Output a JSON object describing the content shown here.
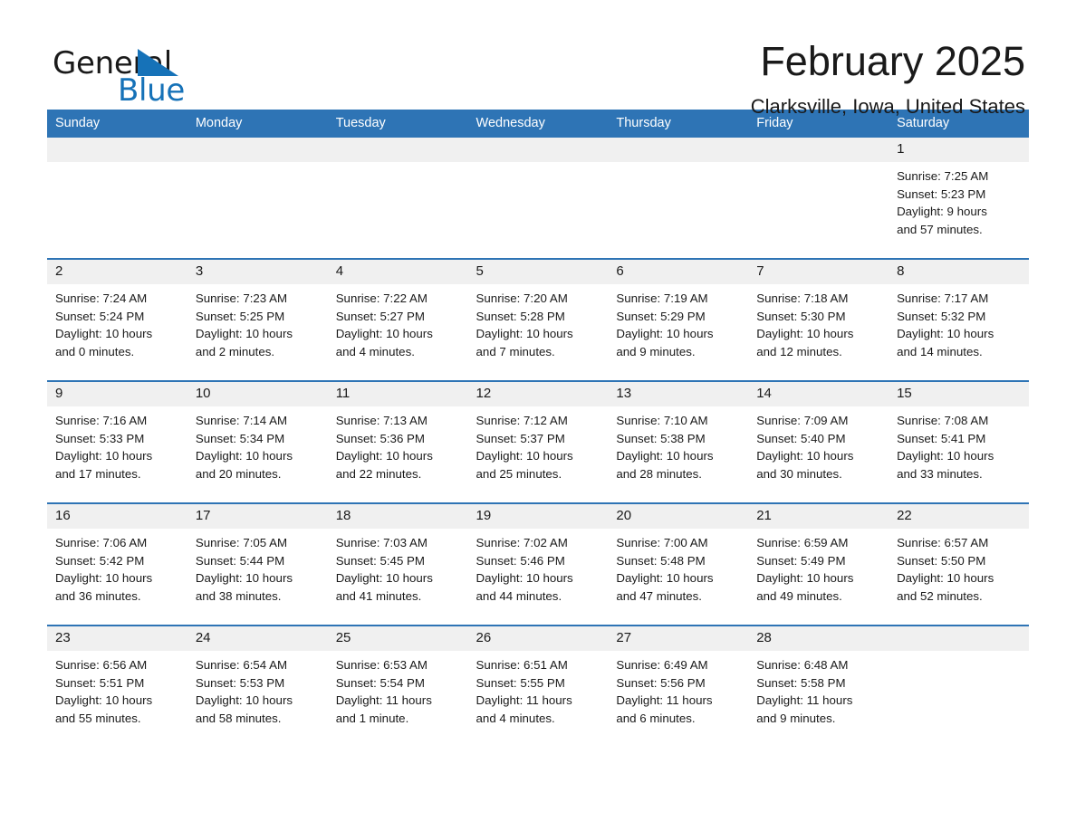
{
  "brand": {
    "name_part1": "General",
    "name_part2": "Blue",
    "accent_color": "#1672b8"
  },
  "header": {
    "month_title": "February 2025",
    "location": "Clarksville, Iowa, United States"
  },
  "theme": {
    "header_blue": "#2e74b5",
    "daynum_bg": "#f0f0f0"
  },
  "weekdays": [
    "Sunday",
    "Monday",
    "Tuesday",
    "Wednesday",
    "Thursday",
    "Friday",
    "Saturday"
  ],
  "labels": {
    "sunrise_prefix": "Sunrise:",
    "sunset_prefix": "Sunset:",
    "daylight_prefix": "Daylight:"
  },
  "weeks": [
    [
      {
        "day": "",
        "sunrise": "",
        "sunset": "",
        "daylight_line1": "",
        "daylight_line2": ""
      },
      {
        "day": "",
        "sunrise": "",
        "sunset": "",
        "daylight_line1": "",
        "daylight_line2": ""
      },
      {
        "day": "",
        "sunrise": "",
        "sunset": "",
        "daylight_line1": "",
        "daylight_line2": ""
      },
      {
        "day": "",
        "sunrise": "",
        "sunset": "",
        "daylight_line1": "",
        "daylight_line2": ""
      },
      {
        "day": "",
        "sunrise": "",
        "sunset": "",
        "daylight_line1": "",
        "daylight_line2": ""
      },
      {
        "day": "",
        "sunrise": "",
        "sunset": "",
        "daylight_line1": "",
        "daylight_line2": ""
      },
      {
        "day": "1",
        "sunrise": "Sunrise: 7:25 AM",
        "sunset": "Sunset: 5:23 PM",
        "daylight_line1": "Daylight: 9 hours",
        "daylight_line2": "and 57 minutes."
      }
    ],
    [
      {
        "day": "2",
        "sunrise": "Sunrise: 7:24 AM",
        "sunset": "Sunset: 5:24 PM",
        "daylight_line1": "Daylight: 10 hours",
        "daylight_line2": "and 0 minutes."
      },
      {
        "day": "3",
        "sunrise": "Sunrise: 7:23 AM",
        "sunset": "Sunset: 5:25 PM",
        "daylight_line1": "Daylight: 10 hours",
        "daylight_line2": "and 2 minutes."
      },
      {
        "day": "4",
        "sunrise": "Sunrise: 7:22 AM",
        "sunset": "Sunset: 5:27 PM",
        "daylight_line1": "Daylight: 10 hours",
        "daylight_line2": "and 4 minutes."
      },
      {
        "day": "5",
        "sunrise": "Sunrise: 7:20 AM",
        "sunset": "Sunset: 5:28 PM",
        "daylight_line1": "Daylight: 10 hours",
        "daylight_line2": "and 7 minutes."
      },
      {
        "day": "6",
        "sunrise": "Sunrise: 7:19 AM",
        "sunset": "Sunset: 5:29 PM",
        "daylight_line1": "Daylight: 10 hours",
        "daylight_line2": "and 9 minutes."
      },
      {
        "day": "7",
        "sunrise": "Sunrise: 7:18 AM",
        "sunset": "Sunset: 5:30 PM",
        "daylight_line1": "Daylight: 10 hours",
        "daylight_line2": "and 12 minutes."
      },
      {
        "day": "8",
        "sunrise": "Sunrise: 7:17 AM",
        "sunset": "Sunset: 5:32 PM",
        "daylight_line1": "Daylight: 10 hours",
        "daylight_line2": "and 14 minutes."
      }
    ],
    [
      {
        "day": "9",
        "sunrise": "Sunrise: 7:16 AM",
        "sunset": "Sunset: 5:33 PM",
        "daylight_line1": "Daylight: 10 hours",
        "daylight_line2": "and 17 minutes."
      },
      {
        "day": "10",
        "sunrise": "Sunrise: 7:14 AM",
        "sunset": "Sunset: 5:34 PM",
        "daylight_line1": "Daylight: 10 hours",
        "daylight_line2": "and 20 minutes."
      },
      {
        "day": "11",
        "sunrise": "Sunrise: 7:13 AM",
        "sunset": "Sunset: 5:36 PM",
        "daylight_line1": "Daylight: 10 hours",
        "daylight_line2": "and 22 minutes."
      },
      {
        "day": "12",
        "sunrise": "Sunrise: 7:12 AM",
        "sunset": "Sunset: 5:37 PM",
        "daylight_line1": "Daylight: 10 hours",
        "daylight_line2": "and 25 minutes."
      },
      {
        "day": "13",
        "sunrise": "Sunrise: 7:10 AM",
        "sunset": "Sunset: 5:38 PM",
        "daylight_line1": "Daylight: 10 hours",
        "daylight_line2": "and 28 minutes."
      },
      {
        "day": "14",
        "sunrise": "Sunrise: 7:09 AM",
        "sunset": "Sunset: 5:40 PM",
        "daylight_line1": "Daylight: 10 hours",
        "daylight_line2": "and 30 minutes."
      },
      {
        "day": "15",
        "sunrise": "Sunrise: 7:08 AM",
        "sunset": "Sunset: 5:41 PM",
        "daylight_line1": "Daylight: 10 hours",
        "daylight_line2": "and 33 minutes."
      }
    ],
    [
      {
        "day": "16",
        "sunrise": "Sunrise: 7:06 AM",
        "sunset": "Sunset: 5:42 PM",
        "daylight_line1": "Daylight: 10 hours",
        "daylight_line2": "and 36 minutes."
      },
      {
        "day": "17",
        "sunrise": "Sunrise: 7:05 AM",
        "sunset": "Sunset: 5:44 PM",
        "daylight_line1": "Daylight: 10 hours",
        "daylight_line2": "and 38 minutes."
      },
      {
        "day": "18",
        "sunrise": "Sunrise: 7:03 AM",
        "sunset": "Sunset: 5:45 PM",
        "daylight_line1": "Daylight: 10 hours",
        "daylight_line2": "and 41 minutes."
      },
      {
        "day": "19",
        "sunrise": "Sunrise: 7:02 AM",
        "sunset": "Sunset: 5:46 PM",
        "daylight_line1": "Daylight: 10 hours",
        "daylight_line2": "and 44 minutes."
      },
      {
        "day": "20",
        "sunrise": "Sunrise: 7:00 AM",
        "sunset": "Sunset: 5:48 PM",
        "daylight_line1": "Daylight: 10 hours",
        "daylight_line2": "and 47 minutes."
      },
      {
        "day": "21",
        "sunrise": "Sunrise: 6:59 AM",
        "sunset": "Sunset: 5:49 PM",
        "daylight_line1": "Daylight: 10 hours",
        "daylight_line2": "and 49 minutes."
      },
      {
        "day": "22",
        "sunrise": "Sunrise: 6:57 AM",
        "sunset": "Sunset: 5:50 PM",
        "daylight_line1": "Daylight: 10 hours",
        "daylight_line2": "and 52 minutes."
      }
    ],
    [
      {
        "day": "23",
        "sunrise": "Sunrise: 6:56 AM",
        "sunset": "Sunset: 5:51 PM",
        "daylight_line1": "Daylight: 10 hours",
        "daylight_line2": "and 55 minutes."
      },
      {
        "day": "24",
        "sunrise": "Sunrise: 6:54 AM",
        "sunset": "Sunset: 5:53 PM",
        "daylight_line1": "Daylight: 10 hours",
        "daylight_line2": "and 58 minutes."
      },
      {
        "day": "25",
        "sunrise": "Sunrise: 6:53 AM",
        "sunset": "Sunset: 5:54 PM",
        "daylight_line1": "Daylight: 11 hours",
        "daylight_line2": "and 1 minute."
      },
      {
        "day": "26",
        "sunrise": "Sunrise: 6:51 AM",
        "sunset": "Sunset: 5:55 PM",
        "daylight_line1": "Daylight: 11 hours",
        "daylight_line2": "and 4 minutes."
      },
      {
        "day": "27",
        "sunrise": "Sunrise: 6:49 AM",
        "sunset": "Sunset: 5:56 PM",
        "daylight_line1": "Daylight: 11 hours",
        "daylight_line2": "and 6 minutes."
      },
      {
        "day": "28",
        "sunrise": "Sunrise: 6:48 AM",
        "sunset": "Sunset: 5:58 PM",
        "daylight_line1": "Daylight: 11 hours",
        "daylight_line2": "and 9 minutes."
      },
      {
        "day": "",
        "sunrise": "",
        "sunset": "",
        "daylight_line1": "",
        "daylight_line2": ""
      }
    ]
  ]
}
